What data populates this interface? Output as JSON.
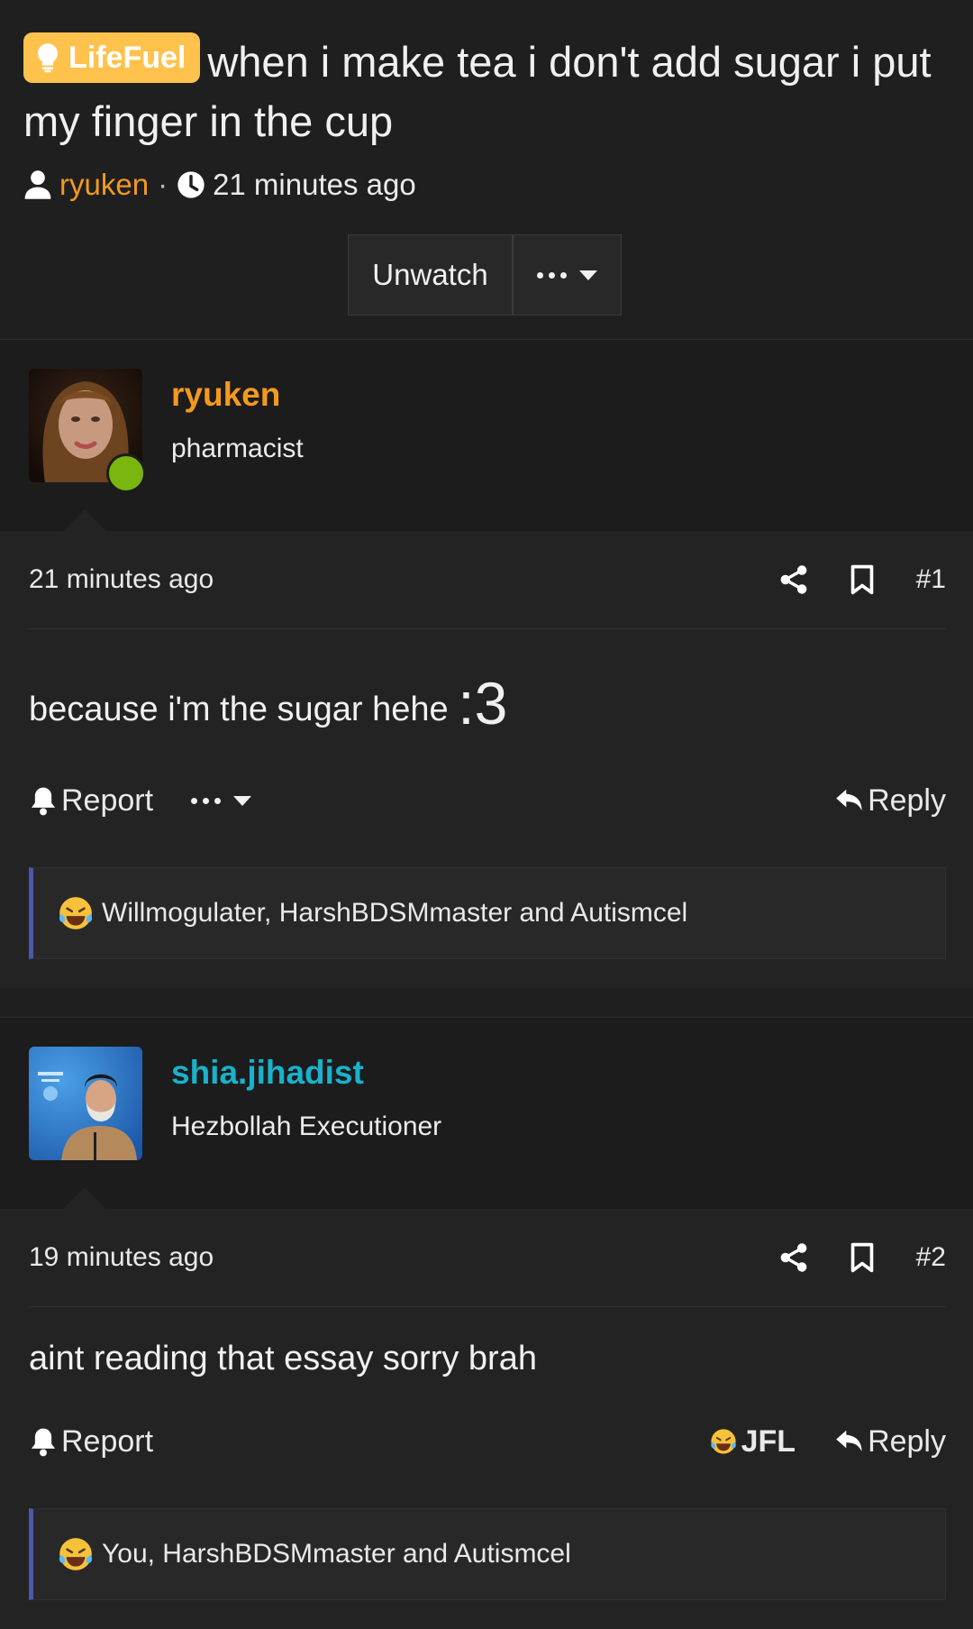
{
  "thread": {
    "prefix": "LifeFuel",
    "title": "when i make tea i don't add sugar i put my finger in the cup",
    "author": "ryuken",
    "separator": "·",
    "time": "21 minutes ago",
    "unwatch_label": "Unwatch"
  },
  "posts": [
    {
      "username": "ryuken",
      "username_color": "#f39a1e",
      "user_title": "pharmacist",
      "online": true,
      "time": "21 minutes ago",
      "number": "#1",
      "content": "because i'm the sugar hehe ",
      "content_smiley": ":3",
      "report_label": "Report",
      "reply_label": "Reply",
      "reaction_users": "Willmogulater, HarshBDSMmaster and Autismcel"
    },
    {
      "username": "shia.jihadist",
      "username_color": "#18b2cc",
      "user_title": "Hezbollah Executioner",
      "time": "19 minutes ago",
      "number": "#2",
      "content": "aint reading that essay sorry brah",
      "report_label": "Report",
      "jfl_label": "JFL",
      "reply_label": "Reply",
      "reaction_users": "You, HarshBDSMmaster and Autismcel"
    }
  ],
  "colors": {
    "prefix_bg": "#ffc24d",
    "accent_bar": "#4f57a8",
    "online": "#7ab60f"
  }
}
